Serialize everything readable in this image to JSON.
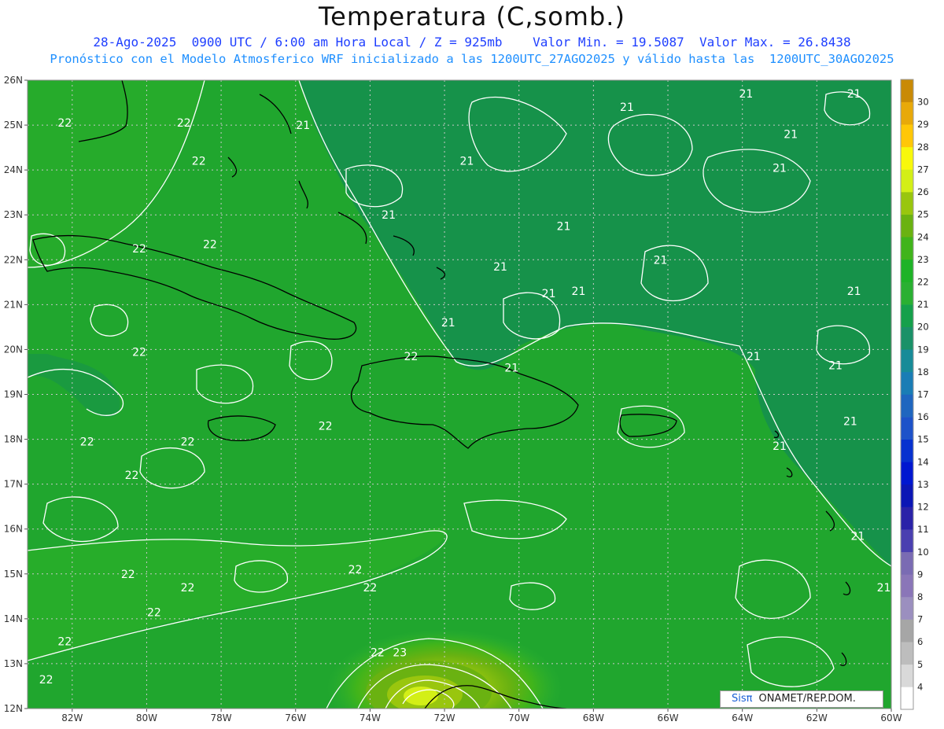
{
  "title": "Temperatura (C,somb.)",
  "subtitle_line1": "28-Ago-2025  0900 UTC / 6:00 am Hora Local / Z = 925mb    Valor Min. = 19.5087  Valor Max. = 26.8438",
  "subtitle_line2": "Pronóstico con el Modelo Atmosferico WRF inicializado a las 1200UTC_27AGO2025 y válido hasta las  1200UTC_30AGO2025",
  "credit": {
    "brand": "Sisπ",
    "rest": "ONAMET/REP.DOM."
  },
  "map": {
    "lat_range": [
      12,
      26
    ],
    "lon_range": [
      -83.2,
      -60
    ],
    "lat_ticks": [
      "12N",
      "13N",
      "14N",
      "15N",
      "16N",
      "17N",
      "18N",
      "19N",
      "20N",
      "21N",
      "22N",
      "23N",
      "24N",
      "25N",
      "26N"
    ],
    "lon_ticks": [
      "82W",
      "80W",
      "78W",
      "76W",
      "74W",
      "72W",
      "70W",
      "68W",
      "66W",
      "64W",
      "62W",
      "60W"
    ],
    "colorbar": {
      "labels": [
        "4",
        "5",
        "6",
        "7",
        "8",
        "9",
        "10",
        "11",
        "12",
        "13",
        "14",
        "15",
        "16",
        "17",
        "18",
        "19",
        "20",
        "21",
        "22",
        "23",
        "24",
        "25",
        "26",
        "27",
        "28",
        "29",
        "30"
      ],
      "colors": [
        "#ffffff",
        "#d9d9d9",
        "#bdbdbd",
        "#a6a6a6",
        "#9b8fbf",
        "#8a76b8",
        "#7a6bb3",
        "#4a3fb0",
        "#2a22a8",
        "#0b16b5",
        "#0017d0",
        "#0731cf",
        "#1d52c9",
        "#1f66bf",
        "#1a7db5",
        "#188b98",
        "#1a9168",
        "#15a04b",
        "#2ab032",
        "#1eb327",
        "#40b41b",
        "#6ab211",
        "#99c60e",
        "#d3ef17",
        "#f8f80b",
        "#ffc707",
        "#e8a90a",
        "#c98a06"
      ]
    },
    "contour_labels": [
      {
        "text": "22",
        "lat": 25.05,
        "lon": -82.2
      },
      {
        "text": "22",
        "lat": 25.05,
        "lon": -79.0
      },
      {
        "text": "21",
        "lat": 25.0,
        "lon": -75.8
      },
      {
        "text": "22",
        "lat": 24.2,
        "lon": -78.6
      },
      {
        "text": "22",
        "lat": 22.25,
        "lon": -80.2
      },
      {
        "text": "22",
        "lat": 22.35,
        "lon": -78.3
      },
      {
        "text": "22",
        "lat": 19.95,
        "lon": -80.2
      },
      {
        "text": "22",
        "lat": 19.85,
        "lon": -72.9
      },
      {
        "text": "21",
        "lat": 23.0,
        "lon": -73.5
      },
      {
        "text": "21",
        "lat": 24.2,
        "lon": -71.4
      },
      {
        "text": "21",
        "lat": 22.75,
        "lon": -68.8
      },
      {
        "text": "21",
        "lat": 21.85,
        "lon": -70.5
      },
      {
        "text": "21",
        "lat": 21.25,
        "lon": -69.2
      },
      {
        "text": "21",
        "lat": 21.3,
        "lon": -68.4
      },
      {
        "text": "21",
        "lat": 20.6,
        "lon": -71.9
      },
      {
        "text": "21",
        "lat": 19.6,
        "lon": -70.2
      },
      {
        "text": "21",
        "lat": 25.4,
        "lon": -67.1
      },
      {
        "text": "21",
        "lat": 25.7,
        "lon": -63.9
      },
      {
        "text": "21",
        "lat": 25.7,
        "lon": -61.0
      },
      {
        "text": "21",
        "lat": 24.8,
        "lon": -62.7
      },
      {
        "text": "21",
        "lat": 24.05,
        "lon": -63.0
      },
      {
        "text": "21",
        "lat": 22.0,
        "lon": -66.2
      },
      {
        "text": "21",
        "lat": 21.3,
        "lon": -61.0
      },
      {
        "text": "21",
        "lat": 19.85,
        "lon": -63.7
      },
      {
        "text": "21",
        "lat": 19.65,
        "lon": -61.5
      },
      {
        "text": "21",
        "lat": 18.4,
        "lon": -61.1
      },
      {
        "text": "21",
        "lat": 17.85,
        "lon": -63.0
      },
      {
        "text": "21",
        "lat": 15.85,
        "lon": -60.9
      },
      {
        "text": "21",
        "lat": 14.7,
        "lon": -60.2
      },
      {
        "text": "22",
        "lat": 17.95,
        "lon": -81.6
      },
      {
        "text": "22",
        "lat": 17.95,
        "lon": -78.9
      },
      {
        "text": "22",
        "lat": 18.3,
        "lon": -75.2
      },
      {
        "text": "22",
        "lat": 17.2,
        "lon": -80.4
      },
      {
        "text": "22",
        "lat": 15.0,
        "lon": -80.5
      },
      {
        "text": "22",
        "lat": 14.7,
        "lon": -78.9
      },
      {
        "text": "22",
        "lat": 14.15,
        "lon": -79.8
      },
      {
        "text": "22",
        "lat": 13.5,
        "lon": -82.2
      },
      {
        "text": "22",
        "lat": 12.65,
        "lon": -82.7
      },
      {
        "text": "22",
        "lat": 14.7,
        "lon": -74.0
      },
      {
        "text": "22",
        "lat": 15.1,
        "lon": -74.4
      },
      {
        "text": "22",
        "lat": 13.25,
        "lon": -73.8
      },
      {
        "text": "23",
        "lat": 13.25,
        "lon": -73.2
      }
    ]
  }
}
